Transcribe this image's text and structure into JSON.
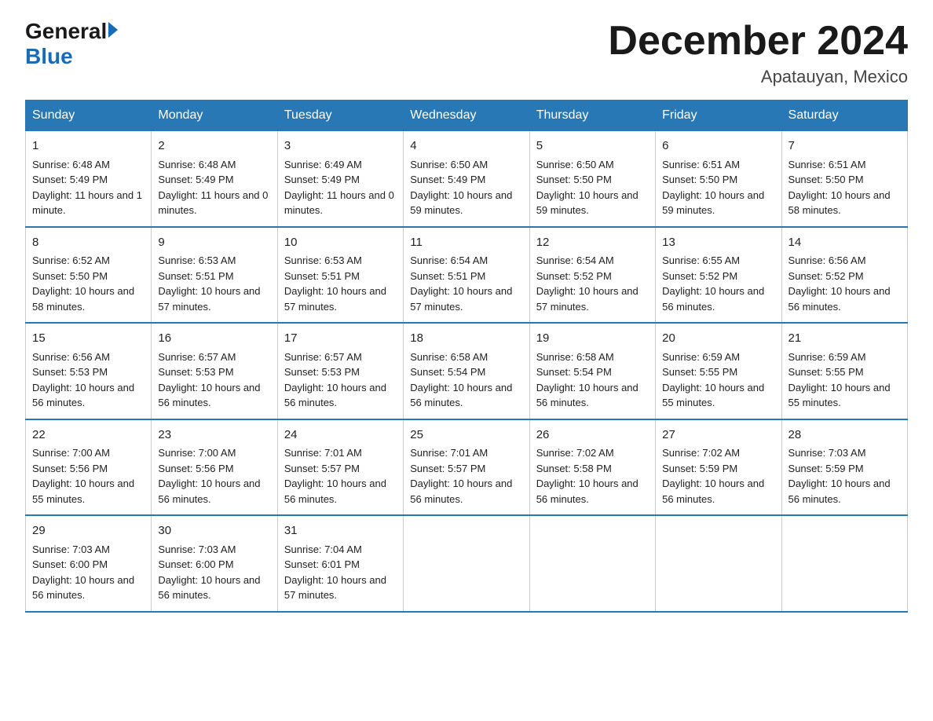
{
  "logo": {
    "general": "General",
    "arrow": "▶",
    "blue": "Blue"
  },
  "title": "December 2024",
  "location": "Apatauyan, Mexico",
  "days_header": [
    "Sunday",
    "Monday",
    "Tuesday",
    "Wednesday",
    "Thursday",
    "Friday",
    "Saturday"
  ],
  "weeks": [
    [
      {
        "day": "1",
        "sunrise": "6:48 AM",
        "sunset": "5:49 PM",
        "daylight": "11 hours and 1 minute."
      },
      {
        "day": "2",
        "sunrise": "6:48 AM",
        "sunset": "5:49 PM",
        "daylight": "11 hours and 0 minutes."
      },
      {
        "day": "3",
        "sunrise": "6:49 AM",
        "sunset": "5:49 PM",
        "daylight": "11 hours and 0 minutes."
      },
      {
        "day": "4",
        "sunrise": "6:50 AM",
        "sunset": "5:49 PM",
        "daylight": "10 hours and 59 minutes."
      },
      {
        "day": "5",
        "sunrise": "6:50 AM",
        "sunset": "5:50 PM",
        "daylight": "10 hours and 59 minutes."
      },
      {
        "day": "6",
        "sunrise": "6:51 AM",
        "sunset": "5:50 PM",
        "daylight": "10 hours and 59 minutes."
      },
      {
        "day": "7",
        "sunrise": "6:51 AM",
        "sunset": "5:50 PM",
        "daylight": "10 hours and 58 minutes."
      }
    ],
    [
      {
        "day": "8",
        "sunrise": "6:52 AM",
        "sunset": "5:50 PM",
        "daylight": "10 hours and 58 minutes."
      },
      {
        "day": "9",
        "sunrise": "6:53 AM",
        "sunset": "5:51 PM",
        "daylight": "10 hours and 57 minutes."
      },
      {
        "day": "10",
        "sunrise": "6:53 AM",
        "sunset": "5:51 PM",
        "daylight": "10 hours and 57 minutes."
      },
      {
        "day": "11",
        "sunrise": "6:54 AM",
        "sunset": "5:51 PM",
        "daylight": "10 hours and 57 minutes."
      },
      {
        "day": "12",
        "sunrise": "6:54 AM",
        "sunset": "5:52 PM",
        "daylight": "10 hours and 57 minutes."
      },
      {
        "day": "13",
        "sunrise": "6:55 AM",
        "sunset": "5:52 PM",
        "daylight": "10 hours and 56 minutes."
      },
      {
        "day": "14",
        "sunrise": "6:56 AM",
        "sunset": "5:52 PM",
        "daylight": "10 hours and 56 minutes."
      }
    ],
    [
      {
        "day": "15",
        "sunrise": "6:56 AM",
        "sunset": "5:53 PM",
        "daylight": "10 hours and 56 minutes."
      },
      {
        "day": "16",
        "sunrise": "6:57 AM",
        "sunset": "5:53 PM",
        "daylight": "10 hours and 56 minutes."
      },
      {
        "day": "17",
        "sunrise": "6:57 AM",
        "sunset": "5:53 PM",
        "daylight": "10 hours and 56 minutes."
      },
      {
        "day": "18",
        "sunrise": "6:58 AM",
        "sunset": "5:54 PM",
        "daylight": "10 hours and 56 minutes."
      },
      {
        "day": "19",
        "sunrise": "6:58 AM",
        "sunset": "5:54 PM",
        "daylight": "10 hours and 56 minutes."
      },
      {
        "day": "20",
        "sunrise": "6:59 AM",
        "sunset": "5:55 PM",
        "daylight": "10 hours and 55 minutes."
      },
      {
        "day": "21",
        "sunrise": "6:59 AM",
        "sunset": "5:55 PM",
        "daylight": "10 hours and 55 minutes."
      }
    ],
    [
      {
        "day": "22",
        "sunrise": "7:00 AM",
        "sunset": "5:56 PM",
        "daylight": "10 hours and 55 minutes."
      },
      {
        "day": "23",
        "sunrise": "7:00 AM",
        "sunset": "5:56 PM",
        "daylight": "10 hours and 56 minutes."
      },
      {
        "day": "24",
        "sunrise": "7:01 AM",
        "sunset": "5:57 PM",
        "daylight": "10 hours and 56 minutes."
      },
      {
        "day": "25",
        "sunrise": "7:01 AM",
        "sunset": "5:57 PM",
        "daylight": "10 hours and 56 minutes."
      },
      {
        "day": "26",
        "sunrise": "7:02 AM",
        "sunset": "5:58 PM",
        "daylight": "10 hours and 56 minutes."
      },
      {
        "day": "27",
        "sunrise": "7:02 AM",
        "sunset": "5:59 PM",
        "daylight": "10 hours and 56 minutes."
      },
      {
        "day": "28",
        "sunrise": "7:03 AM",
        "sunset": "5:59 PM",
        "daylight": "10 hours and 56 minutes."
      }
    ],
    [
      {
        "day": "29",
        "sunrise": "7:03 AM",
        "sunset": "6:00 PM",
        "daylight": "10 hours and 56 minutes."
      },
      {
        "day": "30",
        "sunrise": "7:03 AM",
        "sunset": "6:00 PM",
        "daylight": "10 hours and 56 minutes."
      },
      {
        "day": "31",
        "sunrise": "7:04 AM",
        "sunset": "6:01 PM",
        "daylight": "10 hours and 57 minutes."
      },
      null,
      null,
      null,
      null
    ]
  ]
}
